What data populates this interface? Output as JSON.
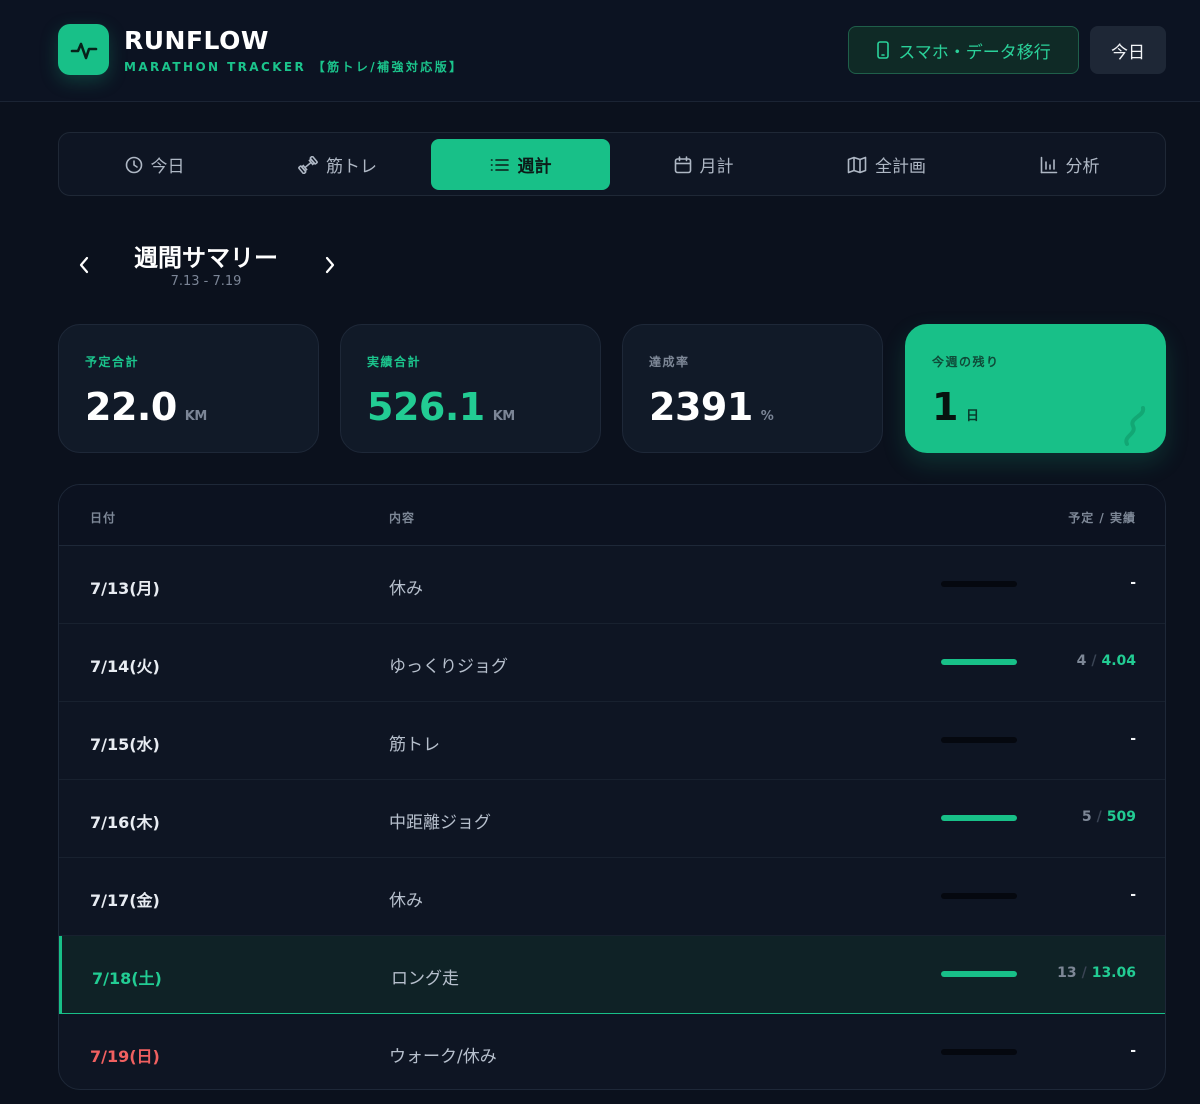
{
  "app": {
    "title": "RUNFLOW",
    "subtitle": "MARATHON TRACKER 【筋トレ/補強対応版】",
    "migrate_button": "スマホ・データ移行",
    "today_button": "今日"
  },
  "tabs": [
    {
      "label": "今日",
      "icon": "clock-icon",
      "active": false
    },
    {
      "label": "筋トレ",
      "icon": "dumbbell-icon",
      "active": false
    },
    {
      "label": "週計",
      "icon": "list-icon",
      "active": true
    },
    {
      "label": "月計",
      "icon": "calendar-icon",
      "active": false
    },
    {
      "label": "全計画",
      "icon": "map-icon",
      "active": false
    },
    {
      "label": "分析",
      "icon": "bar-chart-icon",
      "active": false
    }
  ],
  "week": {
    "title": "週間サマリー",
    "range": "7.13 - 7.19"
  },
  "cards": [
    {
      "label": "予定合計",
      "value": "22.0",
      "unit": "KM"
    },
    {
      "label": "実績合計",
      "value": "526.1",
      "unit": "KM"
    },
    {
      "label": "達成率",
      "value": "2391",
      "unit": "%"
    },
    {
      "label": "今週の残り",
      "value": "1",
      "unit": "日"
    }
  ],
  "table": {
    "headers": {
      "date": "日付",
      "content": "内容",
      "plan_actual": "予定 / 実績"
    },
    "rows": [
      {
        "date": "7/13(月)",
        "content": "休み",
        "value": "-",
        "plan": "",
        "actual": "",
        "progress": 0,
        "highlight": false,
        "date_color": "default"
      },
      {
        "date": "7/14(火)",
        "content": "ゆっくりジョグ",
        "value": "",
        "plan": "4",
        "actual": "4.04",
        "progress": 1,
        "highlight": false,
        "date_color": "default"
      },
      {
        "date": "7/15(水)",
        "content": "筋トレ",
        "value": "-",
        "plan": "",
        "actual": "",
        "progress": 0,
        "highlight": false,
        "date_color": "default"
      },
      {
        "date": "7/16(木)",
        "content": "中距離ジョグ",
        "value": "",
        "plan": "5",
        "actual": "509",
        "progress": 1,
        "highlight": false,
        "date_color": "default"
      },
      {
        "date": "7/17(金)",
        "content": "休み",
        "value": "-",
        "plan": "",
        "actual": "",
        "progress": 0,
        "highlight": false,
        "date_color": "default"
      },
      {
        "date": "7/18(土)",
        "content": "ロング走",
        "value": "",
        "plan": "13",
        "actual": "13.06",
        "progress": 1,
        "highlight": true,
        "date_color": "green"
      },
      {
        "date": "7/19(日)",
        "content": "ウォーク/休み",
        "value": "-",
        "plan": "",
        "actual": "",
        "progress": 0,
        "highlight": false,
        "date_color": "red"
      }
    ]
  },
  "colors": {
    "accent": "#18c088",
    "background": "#0b111d",
    "sunday": "#f06060"
  }
}
